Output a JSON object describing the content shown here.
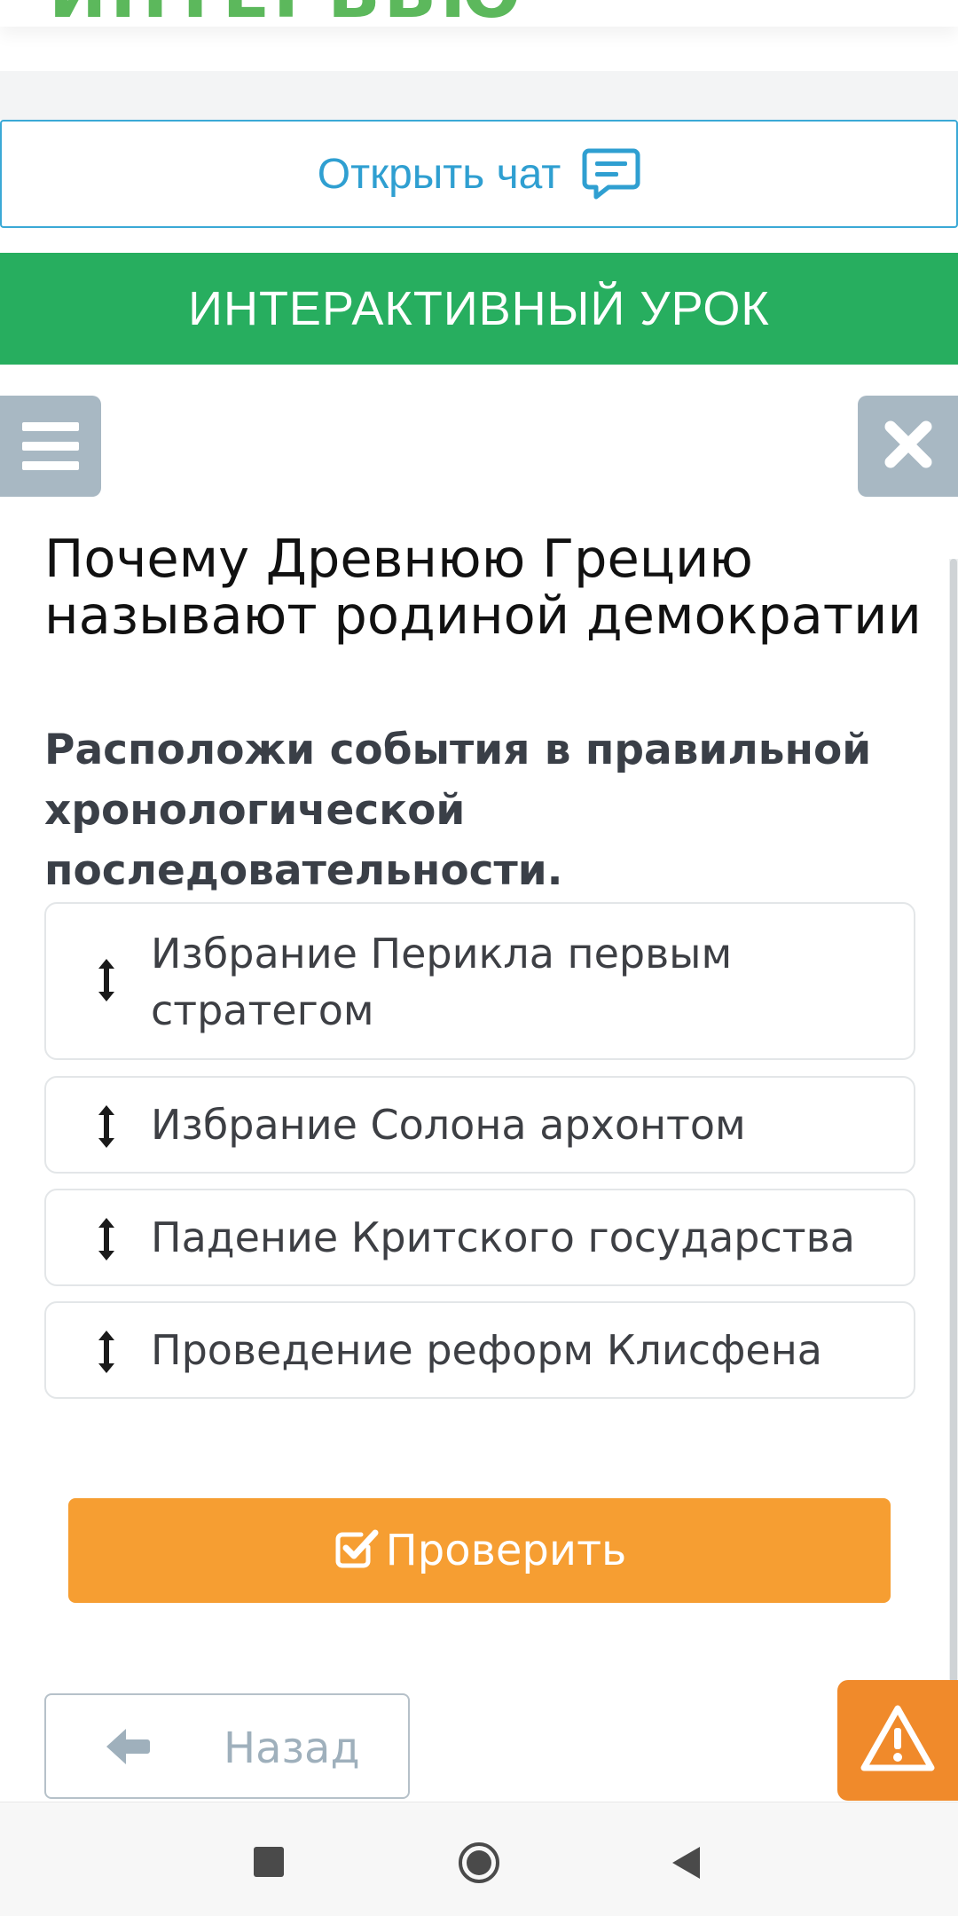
{
  "header": {
    "logo_text": "ИНТЕРВЬЮ"
  },
  "chat": {
    "label": "Открыть чат",
    "icon": "chat-bubble-icon",
    "color": "#2f9fd1"
  },
  "banner": {
    "label": "ИНТЕРАКТИВНЫЙ УРОК",
    "color": "#27ae5f"
  },
  "sidebar": {
    "menu_icon": "hamburger-menu-icon",
    "close_icon": "close-icon"
  },
  "lesson": {
    "title": "Почему Древнюю Грецию называют родиной демократии"
  },
  "task": {
    "instruction": "Расположи события в правильной хронологической последовательности.",
    "items": [
      {
        "label": "Избрание Перикла первым стратегом"
      },
      {
        "label": "Избрание Солона архонтом"
      },
      {
        "label": "Падение Критского государства"
      },
      {
        "label": "Проведение реформ Клисфена"
      }
    ],
    "handle_icon": "up-down-arrow-icon"
  },
  "actions": {
    "check_label": "Проверить",
    "check_icon": "checkbox-check-icon",
    "check_color": "#f69e32",
    "back_label": "Назад",
    "back_icon": "arrow-left-icon",
    "report_icon": "warning-triangle-icon",
    "report_color": "#f08a2b"
  },
  "android_nav": {
    "recent_icon": "square-icon",
    "home_icon": "circle-icon",
    "back_icon": "triangle-back-icon"
  }
}
